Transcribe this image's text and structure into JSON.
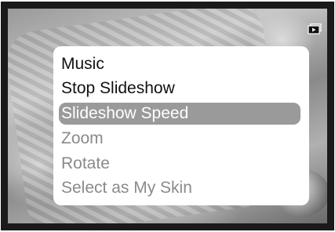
{
  "menu": {
    "items": [
      {
        "label": "Music",
        "state": "enabled"
      },
      {
        "label": "Stop Slideshow",
        "state": "enabled"
      },
      {
        "label": "Slideshow Speed",
        "state": "selected"
      },
      {
        "label": "Zoom",
        "state": "disabled"
      },
      {
        "label": "Rotate",
        "state": "disabled"
      },
      {
        "label": "Select as My Skin",
        "state": "disabled"
      }
    ]
  },
  "status": {
    "icon": "slideshow-icon"
  },
  "colors": {
    "selected_bg": "#9a9a9a",
    "enabled_text": "#111111",
    "disabled_text": "#8a8a8a"
  }
}
